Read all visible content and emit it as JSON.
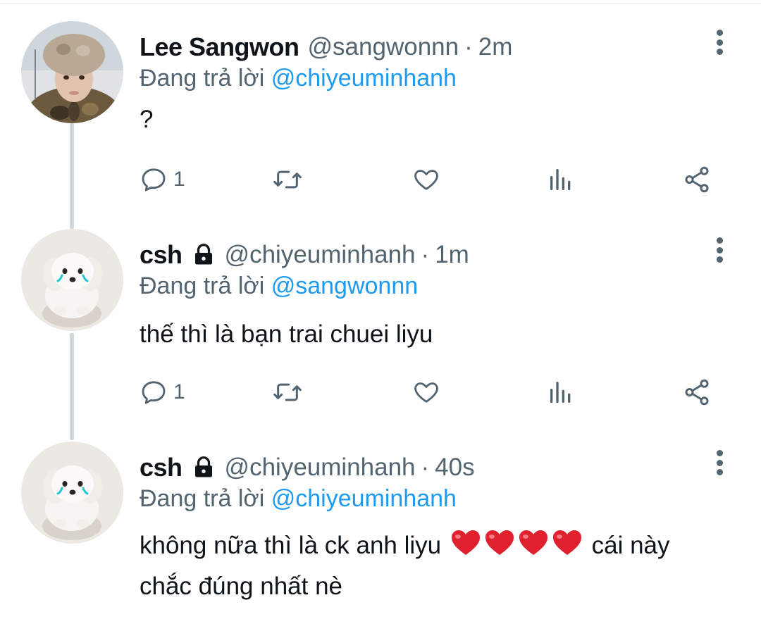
{
  "colors": {
    "accent": "#1d9bf0",
    "secondary_text": "#536471",
    "primary_text": "#0f1419",
    "thread_line": "#cfd9de"
  },
  "tweets": [
    {
      "display_name": "Lee Sangwon",
      "handle": "@sangwonnn",
      "separator": "·",
      "time": "2m",
      "replying_prefix": "Đang trả lời",
      "replying_to": "@chiyeuminhanh",
      "text": "?",
      "reply_count": "1",
      "locked": false,
      "avatar": "person-avatar"
    },
    {
      "display_name": "csh",
      "handle": "@chiyeuminhanh",
      "separator": "·",
      "time": "1m",
      "replying_prefix": "Đang trả lời",
      "replying_to": "@sangwonnn",
      "text": "thế thì là bạn trai chuei liyu",
      "reply_count": "1",
      "locked": true,
      "avatar": "puppy-avatar"
    },
    {
      "display_name": "csh",
      "handle": "@chiyeuminhanh",
      "separator": "·",
      "time": "40s",
      "replying_prefix": "Đang trả lời",
      "replying_to": "@chiyeuminhanh",
      "text_before": "không nữa thì là ck anh liyu",
      "emoji": "❤️❤️❤️❤️",
      "text_after": "cái này",
      "text_line2": "chắc đúng nhất nè",
      "locked": true,
      "avatar": "puppy-avatar"
    }
  ],
  "icons": [
    "reply-icon",
    "retweet-icon",
    "like-icon",
    "analytics-icon",
    "share-icon",
    "more-options-icon",
    "lock-icon"
  ]
}
